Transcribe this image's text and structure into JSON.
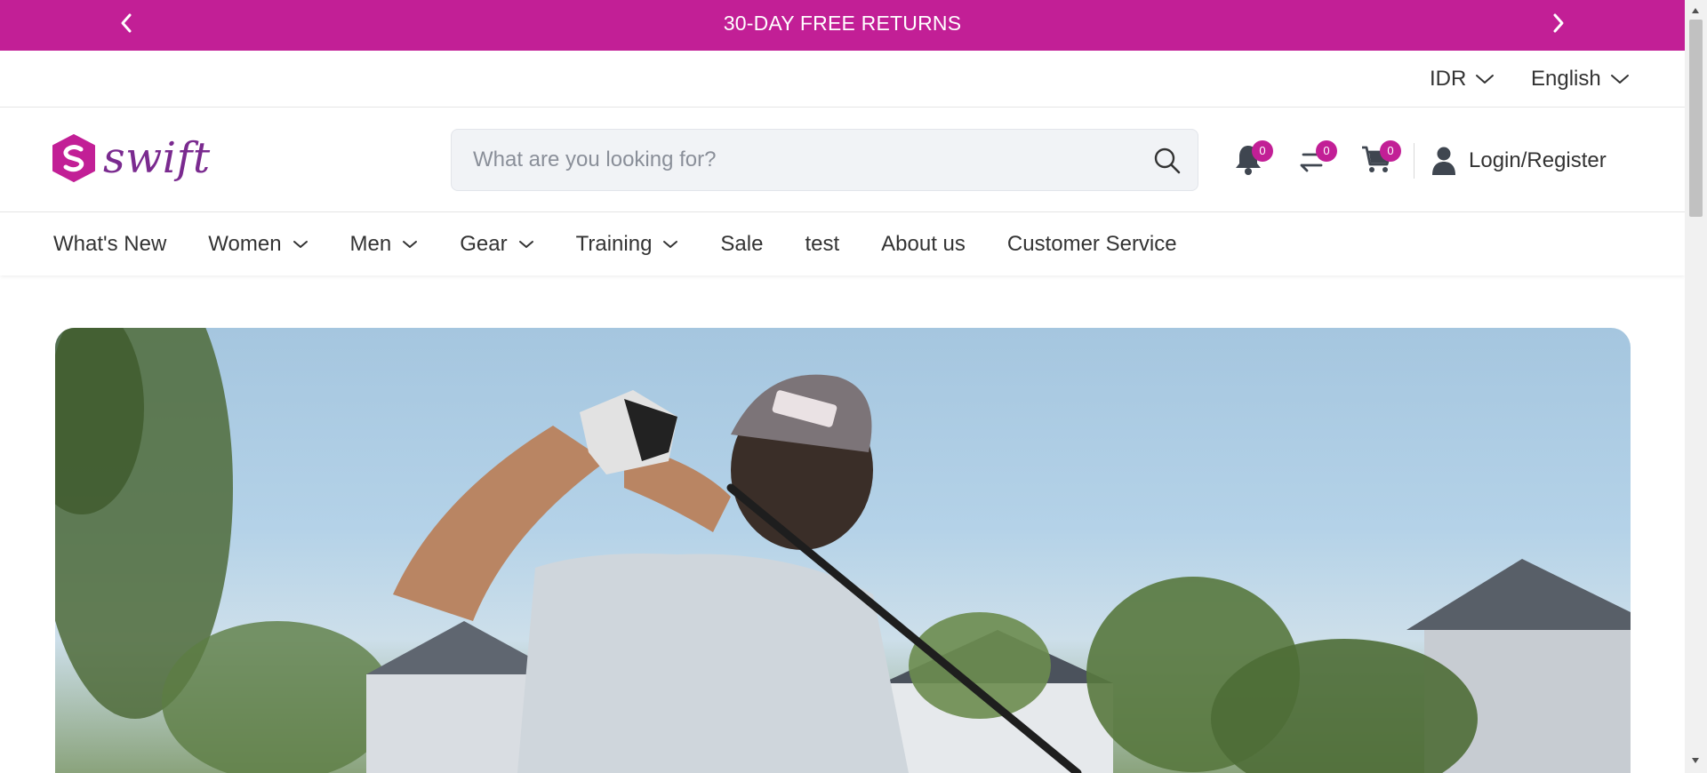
{
  "promo": {
    "text": "30-DAY FREE RETURNS",
    "prev_icon": "chevron-left-icon",
    "next_icon": "chevron-right-icon"
  },
  "topbar": {
    "currency": "IDR",
    "language": "English"
  },
  "header": {
    "logo_text": "swift",
    "search_placeholder": "What are you looking for?",
    "notifications_count": "0",
    "compare_count": "0",
    "cart_count": "0",
    "login_label": "Login/Register"
  },
  "nav": {
    "items": [
      {
        "label": "What's New"
      },
      {
        "label": "Women"
      },
      {
        "label": "Men"
      },
      {
        "label": "Gear"
      },
      {
        "label": "Training"
      },
      {
        "label": "Sale"
      },
      {
        "label": "test"
      },
      {
        "label": "About us"
      },
      {
        "label": "Customer Service"
      }
    ]
  },
  "hero": {
    "image": "golfer-swing-photo"
  },
  "colors": {
    "brand": "#c21f96",
    "logo_purple": "#7a2a8f",
    "search_bg": "#f1f3f6"
  }
}
